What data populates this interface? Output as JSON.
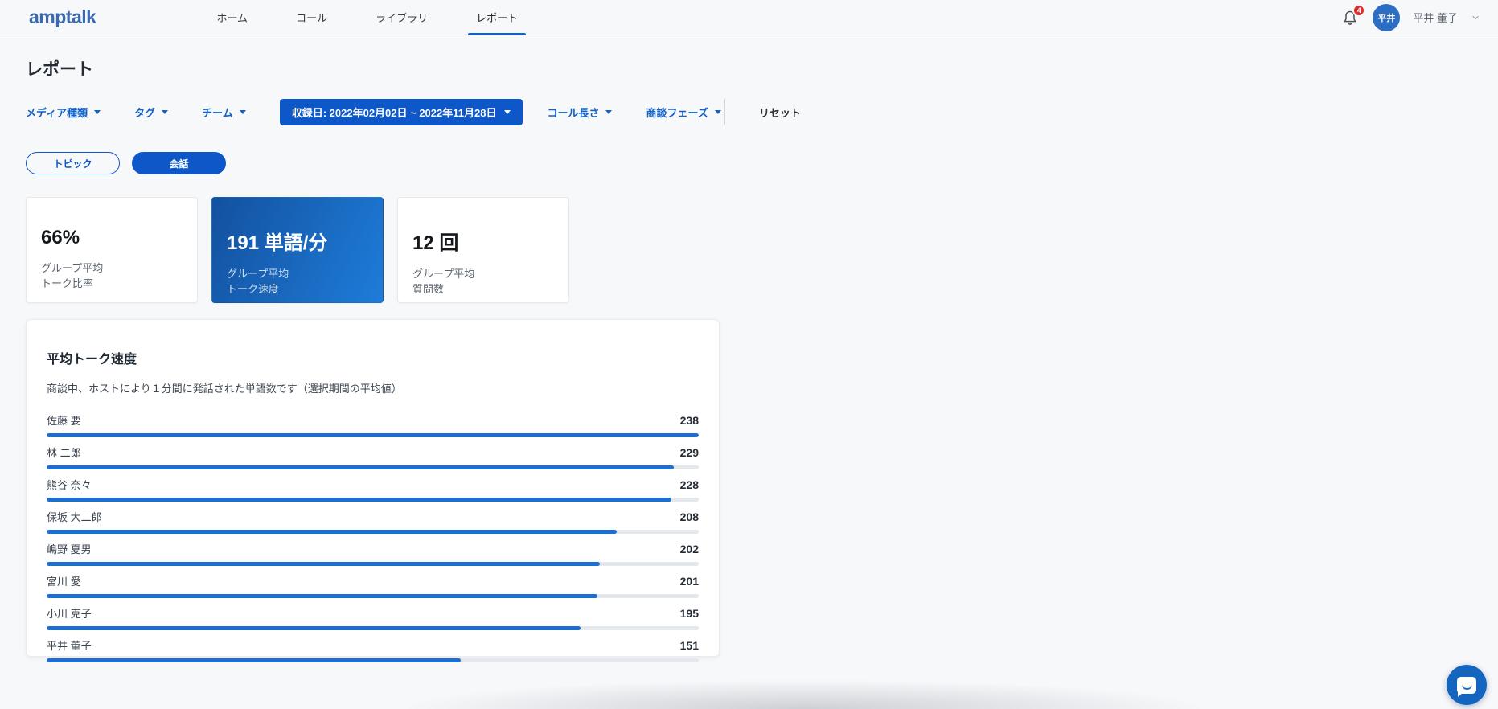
{
  "header": {
    "logo": "amptalk",
    "nav": [
      {
        "label": "ホーム",
        "active": false
      },
      {
        "label": "コール",
        "active": false
      },
      {
        "label": "ライブラリ",
        "active": false
      },
      {
        "label": "レポート",
        "active": true
      }
    ],
    "notification_count": "4",
    "avatar_initials": "平井",
    "user_name": "平井 董子"
  },
  "page": {
    "title": "レポート"
  },
  "filters": {
    "media_type": "メディア種類",
    "tag": "タグ",
    "team": "チーム",
    "date_range": "収録日: 2022年02月02日 ~ 2022年11月28日",
    "call_length": "コール長さ",
    "deal_phase": "商談フェーズ",
    "reset": "リセット"
  },
  "view_toggle": {
    "topic": "トピック",
    "conversation": "会話",
    "active": "会話"
  },
  "stat_cards": [
    {
      "value": "66%",
      "label_line1": "グループ平均",
      "label_line2": "トーク比率",
      "selected": false
    },
    {
      "value": "191 単語/分",
      "label_line1": "グループ平均",
      "label_line2": "トーク速度",
      "selected": true
    },
    {
      "value": "12 回",
      "label_line1": "グループ平均",
      "label_line2": "質問数",
      "selected": false
    }
  ],
  "chart_data": {
    "type": "bar",
    "orientation": "horizontal",
    "title": "平均トーク速度",
    "subtitle": "商談中、ホストにより１分間に発話された単語数です（選択期間の平均値）",
    "categories": [
      "佐藤 要",
      "林 二郎",
      "熊谷 奈々",
      "保坂 大二郎",
      "嶋野 夏男",
      "宮川 愛",
      "小川 克子",
      "平井 董子"
    ],
    "values": [
      238,
      229,
      228,
      208,
      202,
      201,
      195,
      151
    ],
    "max_value": 238,
    "xlim": [
      0,
      238
    ],
    "grid": false,
    "legend": false,
    "bar_color": "#1B6FD1",
    "track_color": "#E4E7EB"
  },
  "colors": {
    "accent_blue": "#0E57C9",
    "bar_blue": "#1B6FD1",
    "logo_blue": "#3A69AD",
    "avatar_blue": "#2B6EC4",
    "badge_red": "#DE2B2B",
    "selected_card_gradient_start": "#13519F",
    "selected_card_gradient_end": "#1E7CD9",
    "page_background": "#F7F8FA"
  },
  "chat_widget": {
    "icon": "chat-bubble-smile"
  }
}
